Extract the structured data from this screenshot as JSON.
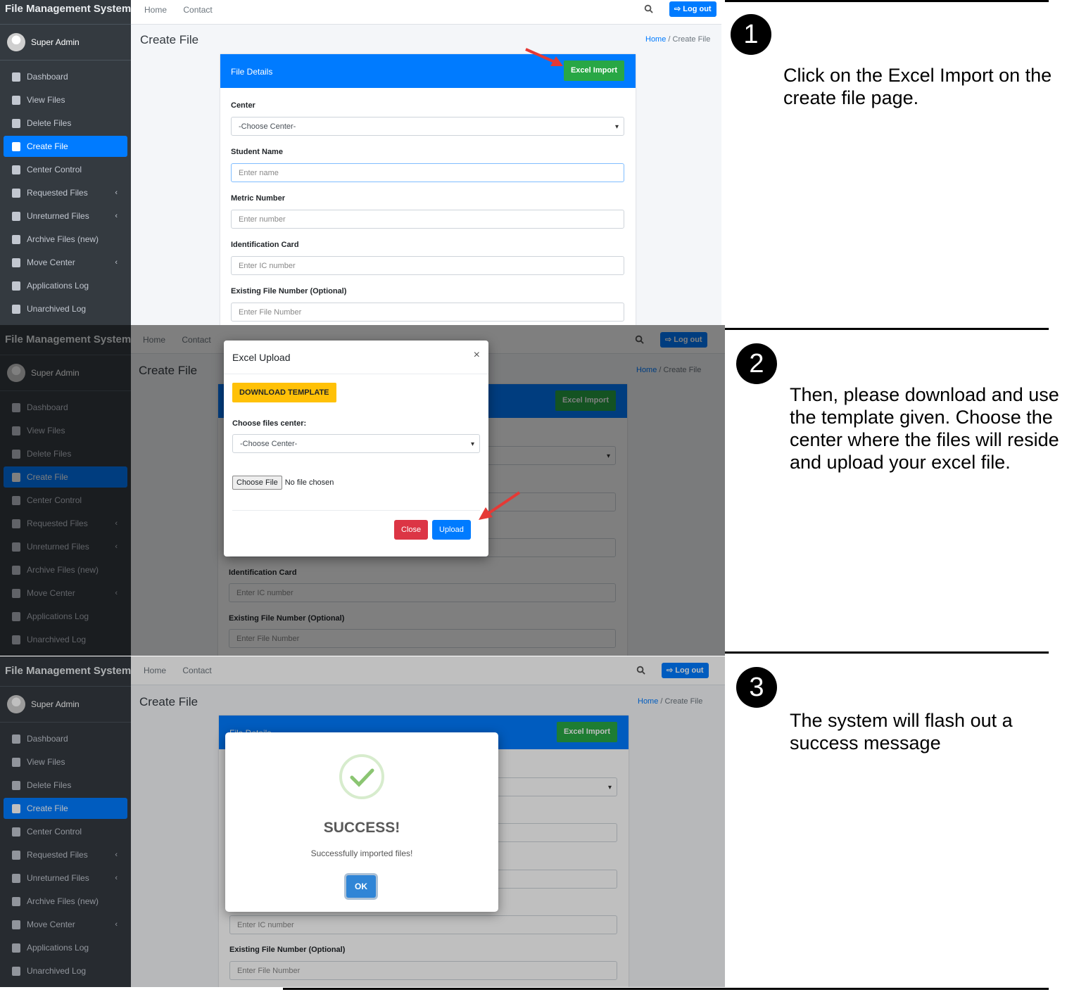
{
  "app": {
    "brand": "File Management System",
    "user": "Super Admin",
    "nav": [
      {
        "label": "Dashboard",
        "icon": "dashboard-icon",
        "caret": false
      },
      {
        "label": "View Files",
        "icon": "file-icon",
        "caret": false
      },
      {
        "label": "Delete Files",
        "icon": "file-icon",
        "caret": false
      },
      {
        "label": "Create File",
        "icon": "file-icon",
        "caret": false,
        "active": true
      },
      {
        "label": "Center Control",
        "icon": "building-icon",
        "caret": false
      },
      {
        "label": "Requested Files",
        "icon": "file-import-icon",
        "caret": true
      },
      {
        "label": "Unreturned Files",
        "icon": "file-return-icon",
        "caret": true
      },
      {
        "label": "Archive Files (new)",
        "icon": "archive-icon",
        "caret": false
      },
      {
        "label": "Move Center",
        "icon": "dolly-icon",
        "caret": true
      },
      {
        "label": "Applications Log",
        "icon": "clipboard-icon",
        "caret": false
      },
      {
        "label": "Unarchived Log",
        "icon": "box-open-icon",
        "caret": false
      }
    ],
    "topnav": [
      "Home",
      "Contact"
    ],
    "logout": "Log out",
    "page_title": "Create File",
    "breadcrumb_home": "Home",
    "breadcrumb_sep": "/",
    "breadcrumb_current": "Create File"
  },
  "form": {
    "card_title": "File Details",
    "excel_import": "Excel Import",
    "center_label": "Center",
    "center_placeholder": "-Choose Center-",
    "student_label": "Student Name",
    "student_placeholder": "Enter name",
    "metric_label": "Metric Number",
    "metric_placeholder": "Enter number",
    "ic_label": "Identification Card",
    "ic_placeholder": "Enter IC number",
    "existing_label": "Existing File Number (Optional)",
    "existing_placeholder": "Enter File Number"
  },
  "upload_modal": {
    "title": "Excel Upload",
    "close_x": "×",
    "download": "DOWNLOAD TEMPLATE",
    "center_label": "Choose files center:",
    "center_placeholder": "-Choose Center-",
    "choose_file": "Choose File",
    "no_file": "No file chosen",
    "close": "Close",
    "upload": "Upload"
  },
  "success_modal": {
    "title": "SUCCESS!",
    "message": "Successfully imported files!",
    "ok": "OK"
  },
  "steps": [
    {
      "num": "1",
      "text": "Click on the Excel Import on the create file page."
    },
    {
      "num": "2",
      "text": "Then, please download and use the template given. Choose the center where the files will reside and upload your excel file."
    },
    {
      "num": "3",
      "text": "The system will flash out a success message"
    }
  ],
  "colors": {
    "primary": "#007bff",
    "success": "#28a745",
    "danger": "#dc3545",
    "warning": "#ffc107",
    "sidebar": "#343a40"
  }
}
